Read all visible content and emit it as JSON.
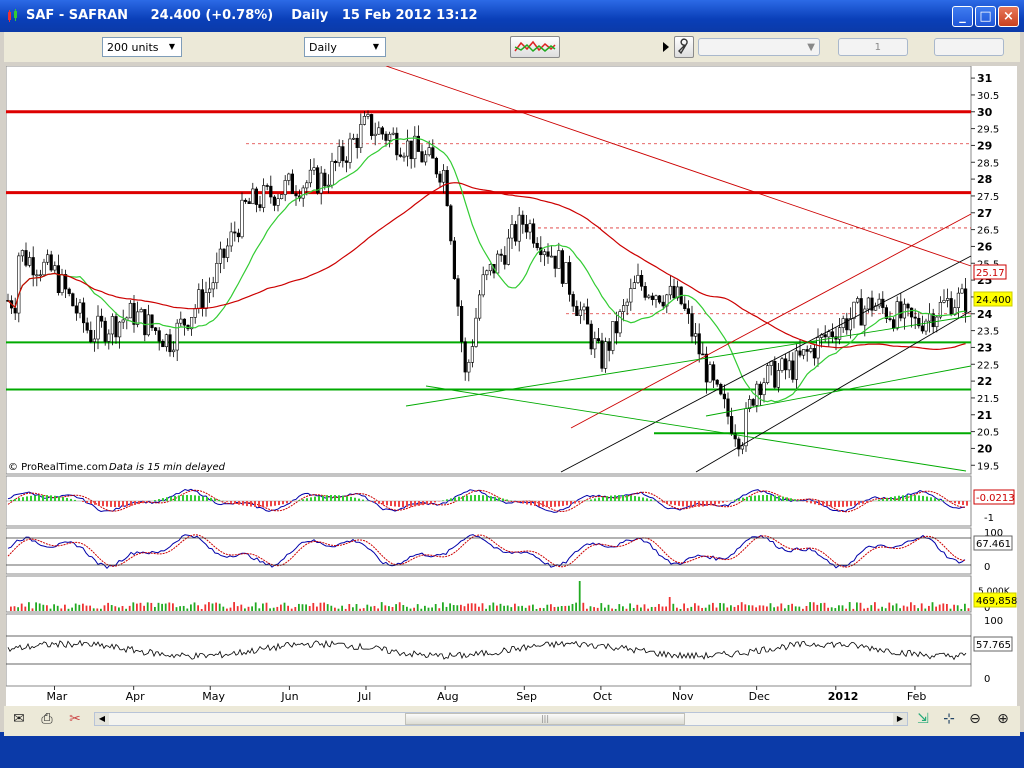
{
  "window": {
    "title": "SAF - SAFRAN     24.400 (+0.78%)    Daily   15 Feb 2012 13:12",
    "minimize": "_",
    "maximize": "□",
    "close": "×"
  },
  "toolbar": {
    "units_select": "200 units",
    "period_select": "Daily",
    "page_number": "1"
  },
  "colors": {
    "price_bars": "#000000",
    "ma_green": "#33cc33",
    "ma_red": "#cc0000",
    "support_red": "#dd0000",
    "support_green": "#00aa00",
    "accent_yellow": "#ffff00"
  },
  "chart_data": [
    {
      "type": "candlestick",
      "title": "",
      "watermark": "© ProRealTime.com",
      "delay_note": "Data is 15 min delayed",
      "x_ticks": [
        "Mar",
        "Apr",
        "May",
        "Jun",
        "Jul",
        "Aug",
        "Sep",
        "Oct",
        "Nov",
        "Dec",
        "2012",
        "Feb"
      ],
      "y_ticks": [
        "31",
        "30.5",
        "30",
        "29.5",
        "29",
        "28.5",
        "28",
        "27.5",
        "27",
        "26.5",
        "26",
        "25.5",
        "25",
        "24.5",
        "24",
        "23.5",
        "23",
        "22.5",
        "22",
        "21.5",
        "21",
        "20.5",
        "20",
        "19.5"
      ],
      "ylim": [
        19.3,
        31.3
      ],
      "last_price": "24.400",
      "ma_red_label": "25.17",
      "horizontal_levels_red": [
        30.0,
        27.6
      ],
      "horizontal_levels_green": [
        23.15,
        21.75,
        20.45
      ],
      "series": [
        {
          "name": "",
          "x": [
            "2011-02-15",
            "2011-03-01",
            "2011-03-15",
            "2011-04-01",
            "2011-04-15",
            "2011-05-01",
            "2011-05-15",
            "2011-06-01",
            "2011-06-15",
            "2011-07-01",
            "2011-07-15",
            "2011-08-01",
            "2011-08-09",
            "2011-08-15",
            "2011-09-01",
            "2011-09-15",
            "2011-10-01",
            "2011-10-15",
            "2011-11-01",
            "2011-11-15",
            "2011-11-25",
            "2011-12-01",
            "2011-12-15",
            "2012-01-01",
            "2012-01-15",
            "2012-02-01",
            "2012-02-15"
          ],
          "close": [
            25.8,
            25.2,
            23.4,
            24.0,
            23.2,
            24.8,
            27.2,
            27.8,
            28.0,
            29.6,
            29.1,
            28.2,
            22.0,
            24.8,
            26.8,
            25.5,
            22.6,
            24.9,
            24.4,
            21.6,
            20.3,
            22.0,
            22.4,
            23.6,
            24.3,
            23.7,
            24.4
          ]
        }
      ]
    },
    {
      "type": "line",
      "title": "",
      "value_label": "-0.0213",
      "y_ticks": [
        "-1"
      ]
    },
    {
      "type": "line",
      "title": "",
      "value_label": "67.461",
      "y_ticks": [
        "100",
        "0"
      ]
    },
    {
      "type": "bar",
      "title": "",
      "value_label": "469,858",
      "y_ticks": [
        "5,000K",
        "0"
      ]
    },
    {
      "type": "line",
      "title": "",
      "value_label": "57.765",
      "y_ticks": [
        "100",
        "0"
      ]
    }
  ]
}
